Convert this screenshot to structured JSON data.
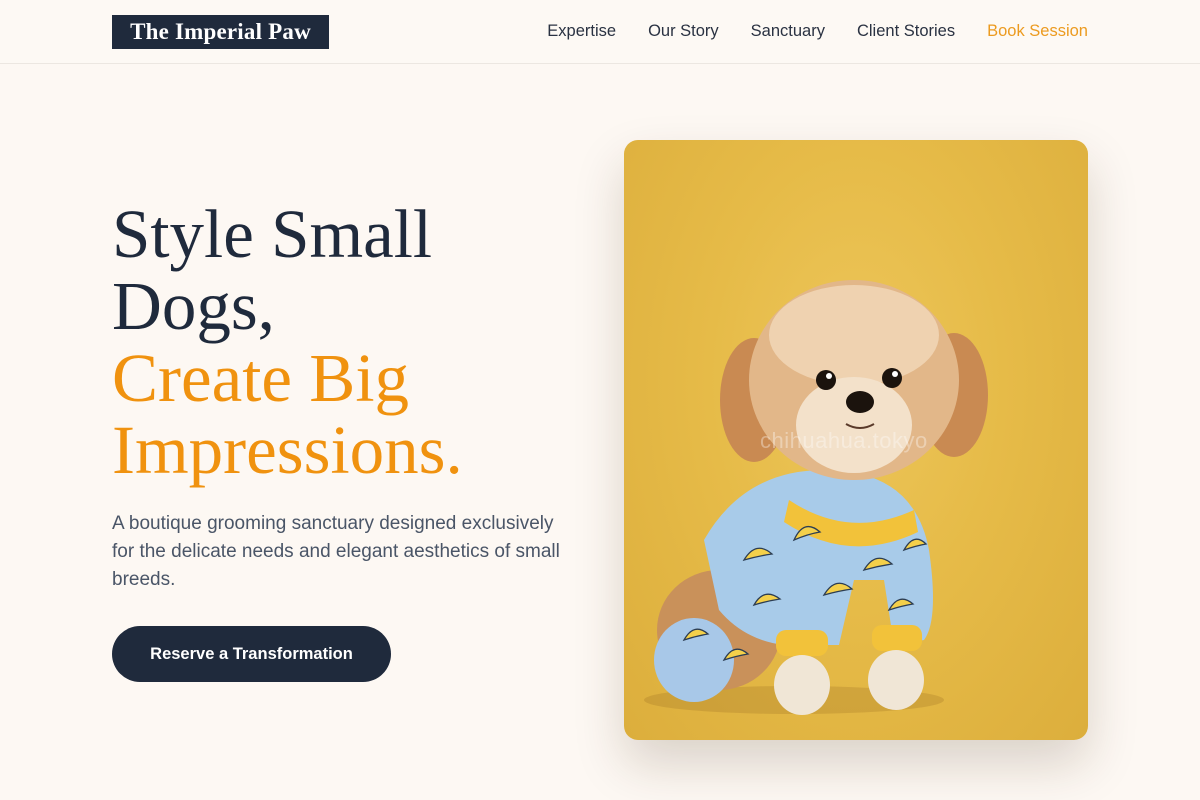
{
  "header": {
    "logo": "The Imperial Paw",
    "nav": [
      {
        "label": "Expertise"
      },
      {
        "label": "Our Story"
      },
      {
        "label": "Sanctuary"
      },
      {
        "label": "Client Stories"
      },
      {
        "label": "Book Session"
      }
    ]
  },
  "hero": {
    "headline_line1": "Style Small",
    "headline_line2": "Dogs,",
    "headline_line3": "Create Big",
    "headline_line4": "Impressions.",
    "subtext": "A boutique grooming sanctuary designed exclusively for the delicate needs and elegant aesthetics of small breeds.",
    "cta_label": "Reserve a Transformation",
    "image": {
      "subject": "small-fluffy-dog-in-banana-print-pajamas",
      "watermark": "chihuahua.tokyo"
    }
  },
  "colors": {
    "navy": "#1f2a3c",
    "accent_orange": "#f0920f",
    "background": "#fdf8f3",
    "image_background": "#e6bb48"
  }
}
